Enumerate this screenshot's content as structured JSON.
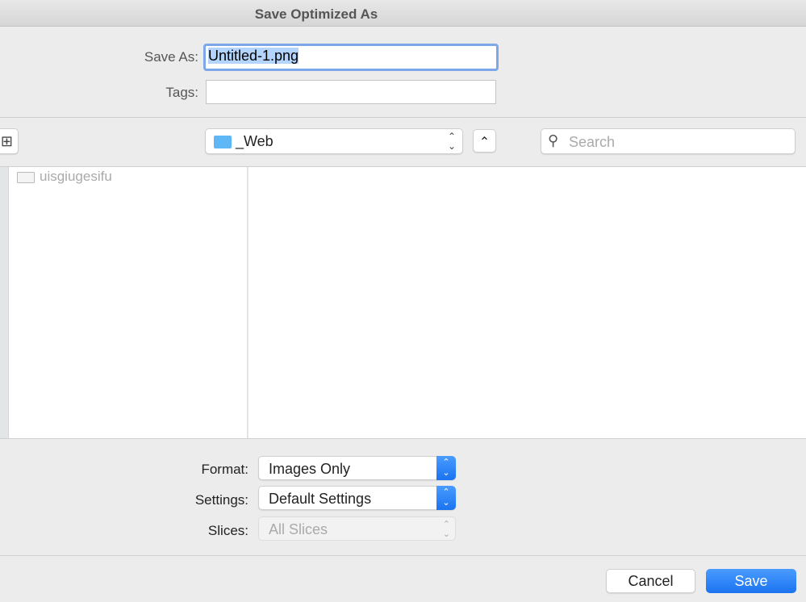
{
  "window": {
    "title": "Save Optimized As"
  },
  "save_as": {
    "label": "Save As:",
    "value": "Untitled-1.png"
  },
  "tags": {
    "label": "Tags:",
    "value": ""
  },
  "toolbar": {
    "location": "_Web",
    "search_placeholder": "Search"
  },
  "sidebar": {
    "items": [
      {
        "label": "uisgiugesifu"
      }
    ]
  },
  "options": {
    "format": {
      "label": "Format:",
      "value": "Images Only"
    },
    "settings": {
      "label": "Settings:",
      "value": "Default Settings"
    },
    "slices": {
      "label": "Slices:",
      "value": "All Slices",
      "disabled": true
    }
  },
  "buttons": {
    "cancel": "Cancel",
    "save": "Save"
  },
  "colors": {
    "accent": "#1a73f0",
    "selection": "#b3d4fd",
    "focus_ring": "#7ea7ea"
  }
}
